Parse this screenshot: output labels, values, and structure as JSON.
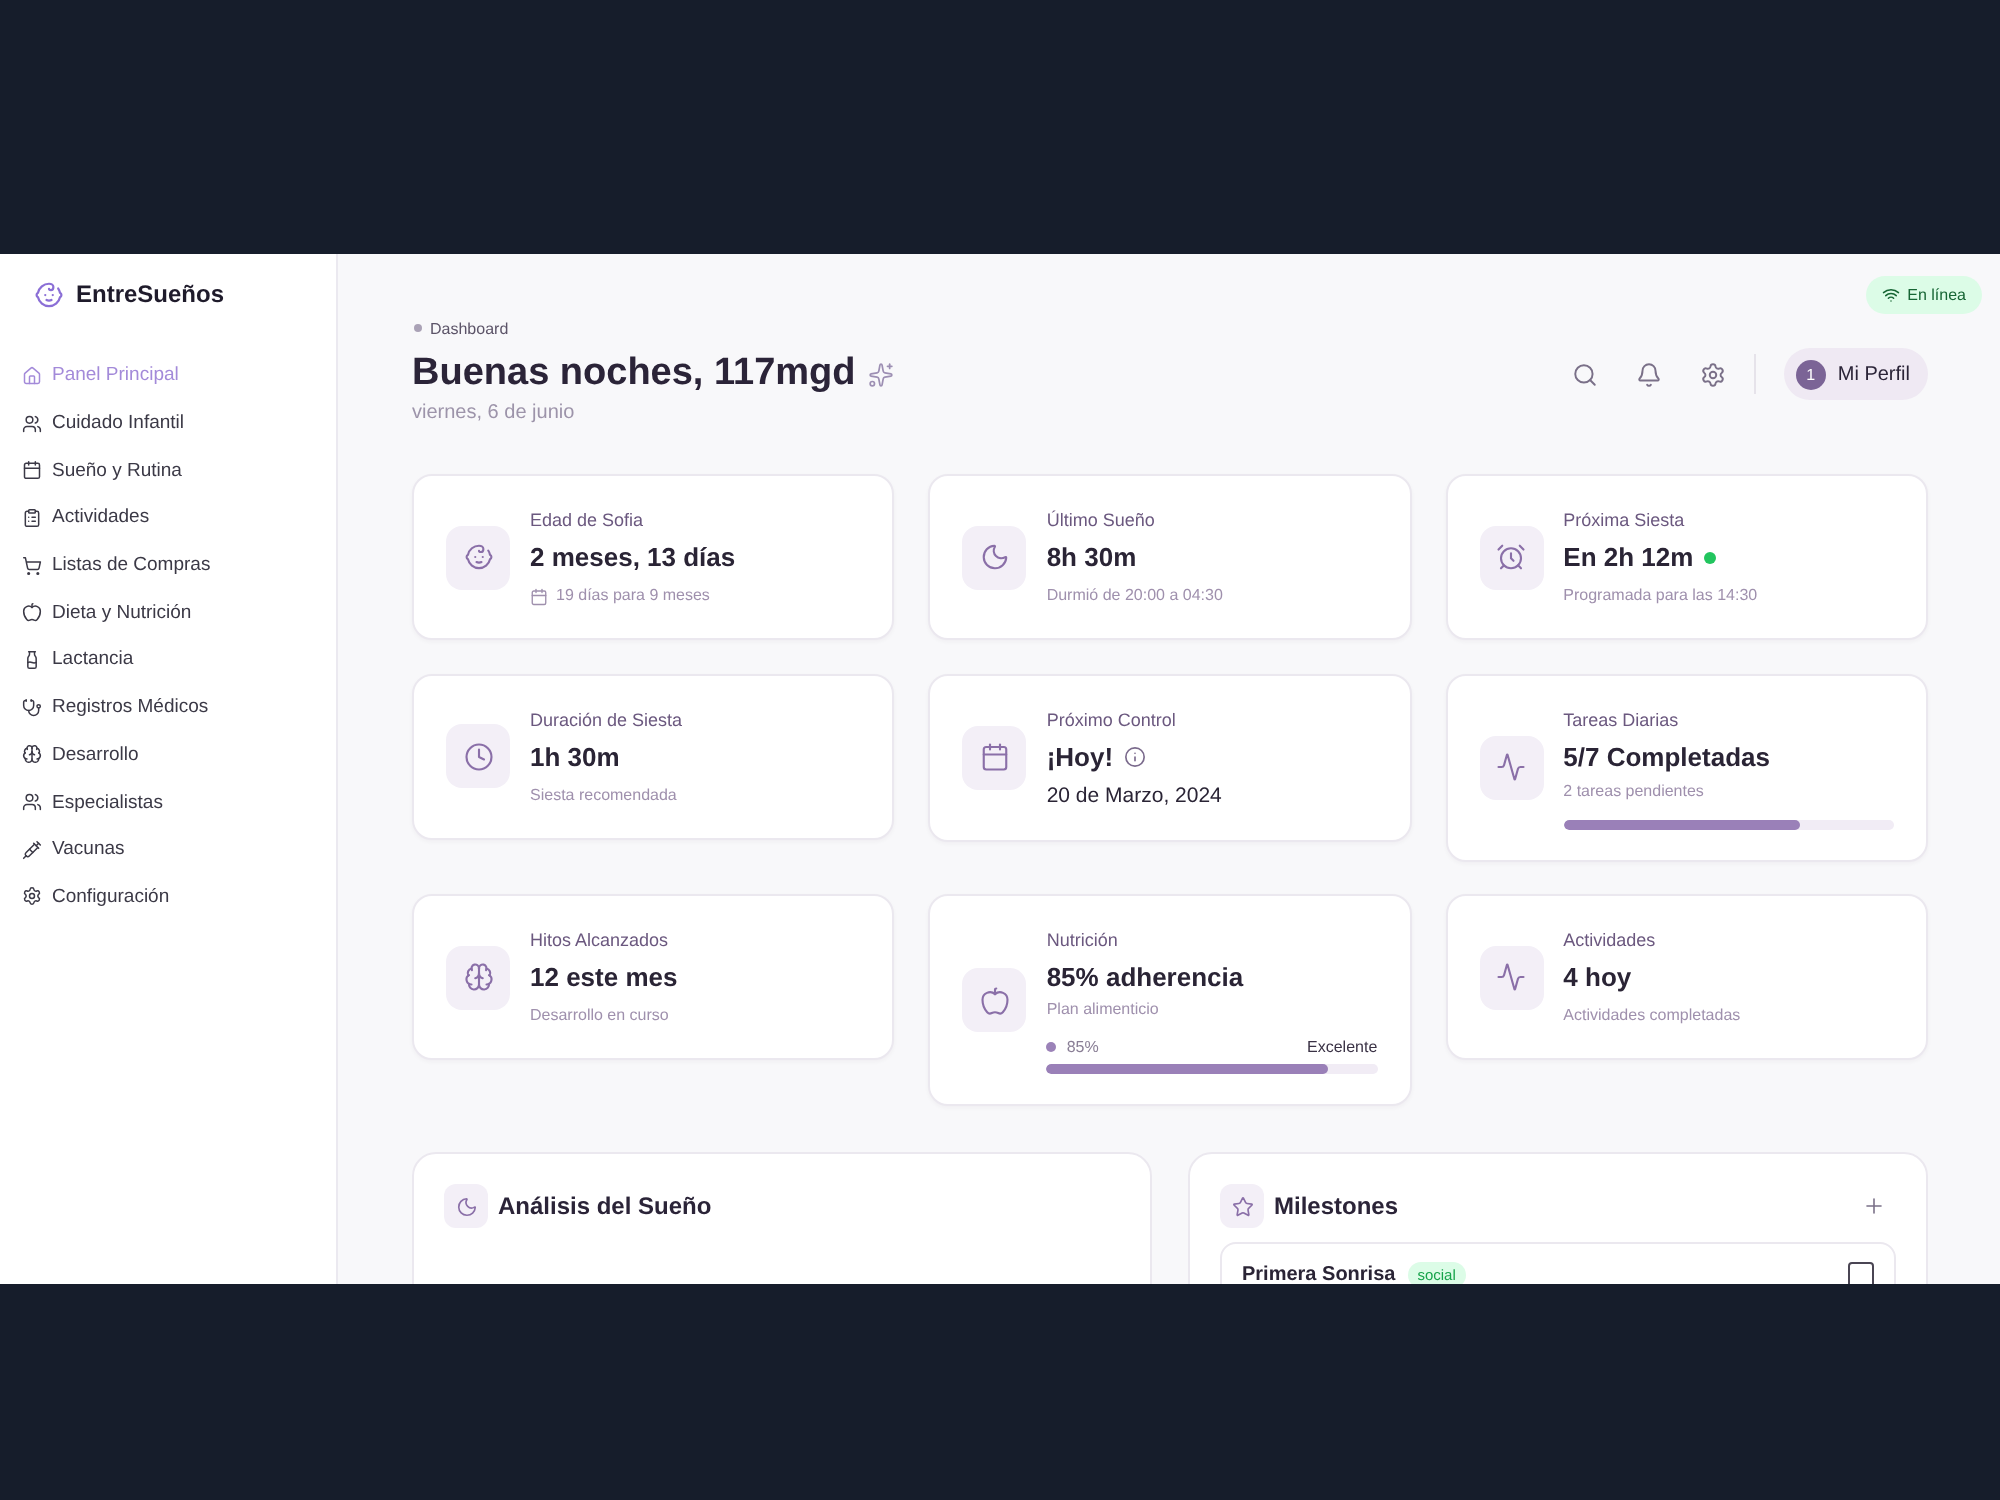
{
  "app": {
    "name": "EntreSueños"
  },
  "sidebar": {
    "items": [
      {
        "label": "Panel Principal",
        "selected": true
      },
      {
        "label": "Cuidado Infantil",
        "selected": false
      },
      {
        "label": "Sueño y Rutina",
        "selected": false
      },
      {
        "label": "Actividades",
        "selected": false
      },
      {
        "label": "Listas de Compras",
        "selected": false
      },
      {
        "label": "Dieta y Nutrición",
        "selected": false
      },
      {
        "label": "Lactancia",
        "selected": false
      },
      {
        "label": "Registros Médicos",
        "selected": false
      },
      {
        "label": "Desarrollo",
        "selected": false
      },
      {
        "label": "Especialistas",
        "selected": false
      },
      {
        "label": "Vacunas",
        "selected": false
      },
      {
        "label": "Configuración",
        "selected": false
      }
    ]
  },
  "status": {
    "label": "En línea"
  },
  "header": {
    "breadcrumb": "Dashboard",
    "title": "Buenas noches, 117mgd",
    "date": "viernes, 6 de junio",
    "profile": {
      "label": "Mi Perfil",
      "badge": "1"
    }
  },
  "cards": [
    {
      "kind": "dated",
      "label": "Edad de Sofia",
      "value": "2 meses, 13 días",
      "note": "19 días para 9 meses"
    },
    {
      "kind": "plain",
      "label": "Último Sueño",
      "value": "8h 30m",
      "note": "Durmió de 20:00 a 04:30"
    },
    {
      "kind": "live",
      "label": "Próxima Siesta",
      "value": "En 2h 12m",
      "note": "Programada para las 14:30"
    },
    {
      "kind": "plain",
      "label": "Duración de Siesta",
      "value": "1h 30m",
      "note": "Siesta recomendada"
    },
    {
      "kind": "alert",
      "label": "Próximo Control",
      "value": "¡Hoy!",
      "detail": "20 de Marzo, 2024"
    },
    {
      "kind": "progress",
      "label": "Tareas Diarias",
      "value": "5/7 Completadas",
      "note": "2 tareas pendientes",
      "level": 0.714
    },
    {
      "kind": "plain",
      "label": "Hitos Alcanzados",
      "value": "12 este mes",
      "note": "Desarrollo en curso"
    },
    {
      "kind": "rated",
      "label": "Nutrición",
      "value": "85% adherencia",
      "note": "Plan alimenticio",
      "reading": "85%",
      "rating": "Excelente",
      "level": 0.85
    },
    {
      "kind": "plain",
      "label": "Actividades",
      "value": "4 hoy",
      "note": "Actividades completadas"
    }
  ],
  "panels": {
    "analysis": {
      "title": "Análisis del Sueño"
    },
    "milestones": {
      "title": "Milestones",
      "items": [
        {
          "title": "Primera Sonrisa",
          "tag": "social",
          "checked": false
        }
      ]
    }
  }
}
